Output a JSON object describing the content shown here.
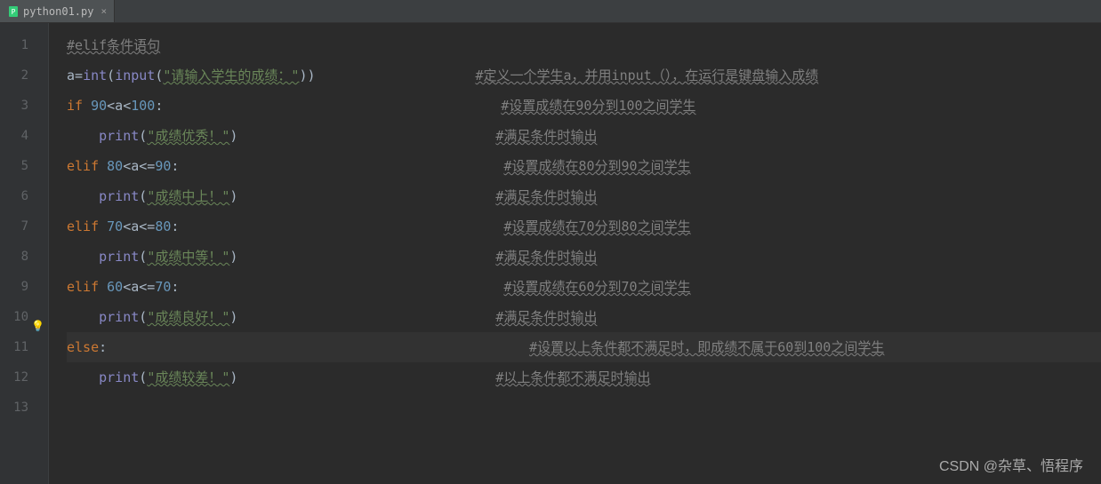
{
  "tab": {
    "filename": "python01.py",
    "close": "×"
  },
  "lines": {
    "l1": {
      "indent": "",
      "c1": "#elif条件语句"
    },
    "l2": {
      "v": "a",
      "op": "=",
      "fn1": "int",
      "p1": "(",
      "fn2": "input",
      "p2": "(",
      "s": "\"请输入学生的成绩：\"",
      "p3": "))",
      "cmt": "#定义一个学生a，并用input（），在运行是键盘输入成绩"
    },
    "l3": {
      "kw": "if ",
      "n1": "90",
      "op": "<a<",
      "n2": "100",
      "colon": ":",
      "cmt": "#设置成绩在90分到100之间学生"
    },
    "l4": {
      "fn": "print",
      "p1": "(",
      "s": "\"成绩优秀！\"",
      "p2": ")",
      "cmt": "#满足条件时输出"
    },
    "l5": {
      "kw": "elif ",
      "n1": "80",
      "op": "<a<=",
      "n2": "90",
      "colon": ":",
      "cmt": "#设置成绩在80分到90之间学生"
    },
    "l6": {
      "fn": "print",
      "p1": "(",
      "s": "\"成绩中上！\"",
      "p2": ")",
      "cmt": "#满足条件时输出"
    },
    "l7": {
      "kw": "elif ",
      "n1": "70",
      "op": "<a<=",
      "n2": "80",
      "colon": ":",
      "cmt": "#设置成绩在70分到80之间学生"
    },
    "l8": {
      "fn": "print",
      "p1": "(",
      "s": "\"成绩中等！\"",
      "p2": ")",
      "cmt": "#满足条件时输出"
    },
    "l9": {
      "kw": "elif ",
      "n1": "60",
      "op": "<a<=",
      "n2": "70",
      "colon": ":",
      "cmt": "#设置成绩在60分到70之间学生"
    },
    "l10": {
      "fn": "print",
      "p1": "(",
      "s": "\"成绩良好！\"",
      "p2": ")",
      "cmt": "#满足条件时输出"
    },
    "l11": {
      "kw": "else",
      "colon": ":",
      "cmt": "#设置以上条件都不满足时，即成绩不属于60到100之间学生"
    },
    "l12": {
      "fn": "print",
      "p1": "(",
      "s": "\"成绩较差！\"",
      "p2": ")",
      "cmt": "#以上条件都不满足时输出"
    }
  },
  "gutter": [
    "1",
    "2",
    "3",
    "4",
    "5",
    "6",
    "7",
    "8",
    "9",
    "10",
    "11",
    "12",
    "13"
  ],
  "watermark": "CSDN @杂草、悟程序"
}
